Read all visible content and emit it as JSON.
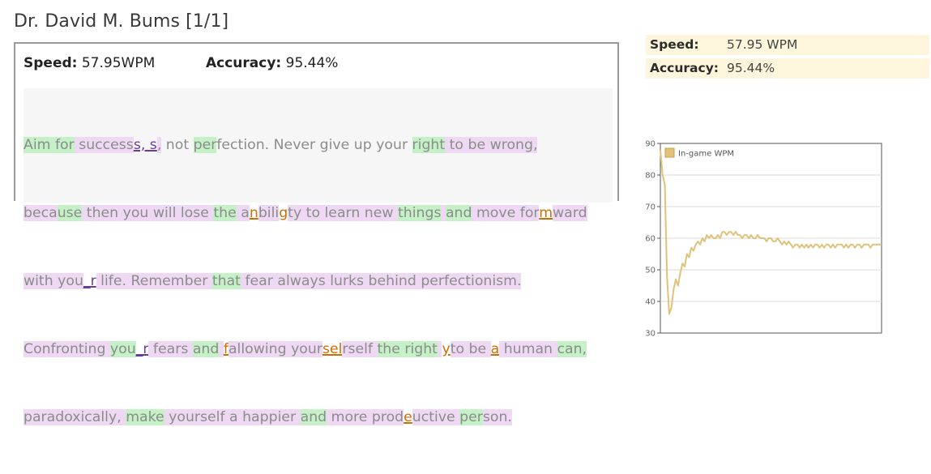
{
  "header": {
    "title": "Dr. David M. Bums [1/1]"
  },
  "result": {
    "speed_label": "Speed:",
    "speed_value": "57.95WPM",
    "accuracy_label": "Accuracy:",
    "accuracy_value": "95.44%"
  },
  "typed_text": {
    "line1": [
      {
        "t": "Aim ",
        "c": "g"
      },
      {
        "t": "for",
        "c": "g"
      },
      {
        "t": " success",
        "c": "p"
      },
      {
        "t": "s, s",
        "c": "errp"
      },
      {
        "t": ",",
        "c": "p"
      },
      {
        "t": " not ",
        "c": ""
      },
      {
        "t": "per",
        "c": "g"
      },
      {
        "t": "fection. Never give up your ",
        "c": ""
      },
      {
        "t": "right",
        "c": "g"
      },
      {
        "t": " to be wrong,",
        "c": "p"
      }
    ],
    "line2": [
      {
        "t": "beca",
        "c": "p"
      },
      {
        "t": "use",
        "c": "g"
      },
      {
        "t": " then you will lose ",
        "c": "p"
      },
      {
        "t": "the",
        "c": "g"
      },
      {
        "t": " a",
        "c": "p"
      },
      {
        "t": "n",
        "c": "err"
      },
      {
        "t": "bili",
        "c": "p"
      },
      {
        "t": "g",
        "c": "err"
      },
      {
        "t": "ty to learn new ",
        "c": "p"
      },
      {
        "t": "things",
        "c": "g"
      },
      {
        "t": " ",
        "c": "p"
      },
      {
        "t": "and",
        "c": "g"
      },
      {
        "t": " move for",
        "c": "p"
      },
      {
        "t": "m",
        "c": "err"
      },
      {
        "t": "ward",
        "c": "p"
      }
    ],
    "line3": [
      {
        "t": "with you",
        "c": "p"
      },
      {
        "t": "_r",
        "c": "errp"
      },
      {
        "t": " life. Remember ",
        "c": "p"
      },
      {
        "t": "that",
        "c": "g"
      },
      {
        "t": " fear always lurks behind perfectionism.",
        "c": "p"
      }
    ],
    "line4": [
      {
        "t": "Confronting ",
        "c": "p"
      },
      {
        "t": "you",
        "c": "g"
      },
      {
        "t": "_r",
        "c": "errp"
      },
      {
        "t": " fears ",
        "c": "p"
      },
      {
        "t": "and",
        "c": "g"
      },
      {
        "t": " ",
        "c": "p"
      },
      {
        "t": "f",
        "c": "err"
      },
      {
        "t": "allowing your",
        "c": "p"
      },
      {
        "t": "sel",
        "c": "err"
      },
      {
        "t": "rself ",
        "c": "p"
      },
      {
        "t": "the right",
        "c": "g"
      },
      {
        "t": " ",
        "c": "p"
      },
      {
        "t": "y",
        "c": "err"
      },
      {
        "t": "to be ",
        "c": "p"
      },
      {
        "t": "a",
        "c": "err"
      },
      {
        "t": " human ",
        "c": "p"
      },
      {
        "t": "can,",
        "c": "g"
      }
    ],
    "line5": [
      {
        "t": "paradoxically, ",
        "c": "p"
      },
      {
        "t": "make",
        "c": "g"
      },
      {
        "t": " yourself a happier ",
        "c": "p"
      },
      {
        "t": "and",
        "c": "g"
      },
      {
        "t": " more prod",
        "c": "p"
      },
      {
        "t": "e",
        "c": "err"
      },
      {
        "t": "uctive ",
        "c": "p"
      },
      {
        "t": "per",
        "c": "g"
      },
      {
        "t": "son.",
        "c": "p"
      }
    ]
  },
  "summary": {
    "speed_label": "Speed:",
    "speed_value": "57.95 WPM",
    "accuracy_label": "Accuracy:",
    "accuracy_value": "95.44%"
  },
  "colors": {
    "correct_highlight": "#c4f1c6",
    "typed_highlight": "#efd8f3",
    "error_text": "#d26b00",
    "chart_line": "#e0c27a",
    "summary_background": "#fdf6dc"
  },
  "chart_data": {
    "type": "line",
    "title": "",
    "xlabel": "",
    "ylabel": "",
    "ylim": [
      30,
      90
    ],
    "yticks": [
      30,
      40,
      50,
      60,
      70,
      80,
      90
    ],
    "grid": true,
    "legend_position": "top-left",
    "series": [
      {
        "name": "In-game WPM",
        "x": [
          0,
          1,
          2,
          3,
          4,
          5,
          6,
          7,
          8,
          9,
          10,
          11,
          12,
          13,
          14,
          15,
          16,
          17,
          18,
          19,
          20,
          21,
          22,
          23,
          24,
          25,
          26,
          27,
          28,
          29,
          30,
          31,
          32,
          33,
          34,
          35,
          36,
          37,
          38,
          39,
          40,
          41,
          42,
          43,
          44,
          45,
          46,
          47,
          48,
          49,
          50,
          51,
          52,
          53,
          54,
          55,
          56,
          57,
          58,
          59,
          60,
          61,
          62,
          63,
          64,
          65,
          66,
          67,
          68,
          69,
          70,
          71,
          72,
          73,
          74,
          75,
          76,
          77,
          78,
          79,
          80,
          81,
          82,
          83,
          84,
          85,
          86,
          87,
          88,
          89,
          90,
          91,
          92,
          93,
          94,
          95,
          96,
          97,
          98,
          99,
          100
        ],
        "values": [
          88,
          80,
          77,
          48,
          36,
          38,
          44,
          47,
          45,
          49,
          52,
          51,
          55,
          54,
          57,
          56,
          58,
          59,
          58,
          60,
          59,
          61,
          60,
          61,
          60,
          60,
          61,
          60,
          62,
          62,
          61,
          62,
          62,
          61,
          62,
          61,
          61,
          60,
          61,
          61,
          60,
          61,
          60,
          60,
          61,
          60,
          60,
          60,
          59,
          60,
          60,
          59,
          59,
          60,
          59,
          58,
          59,
          58,
          59,
          58,
          57,
          58,
          58,
          57,
          58,
          57,
          58,
          57,
          58,
          57,
          58,
          58,
          57,
          58,
          57,
          58,
          58,
          57,
          58,
          57,
          58,
          58,
          58,
          57,
          58,
          57,
          58,
          58,
          57,
          58,
          58,
          57,
          58,
          58,
          58,
          57,
          58,
          58,
          58,
          58,
          58
        ]
      }
    ]
  }
}
